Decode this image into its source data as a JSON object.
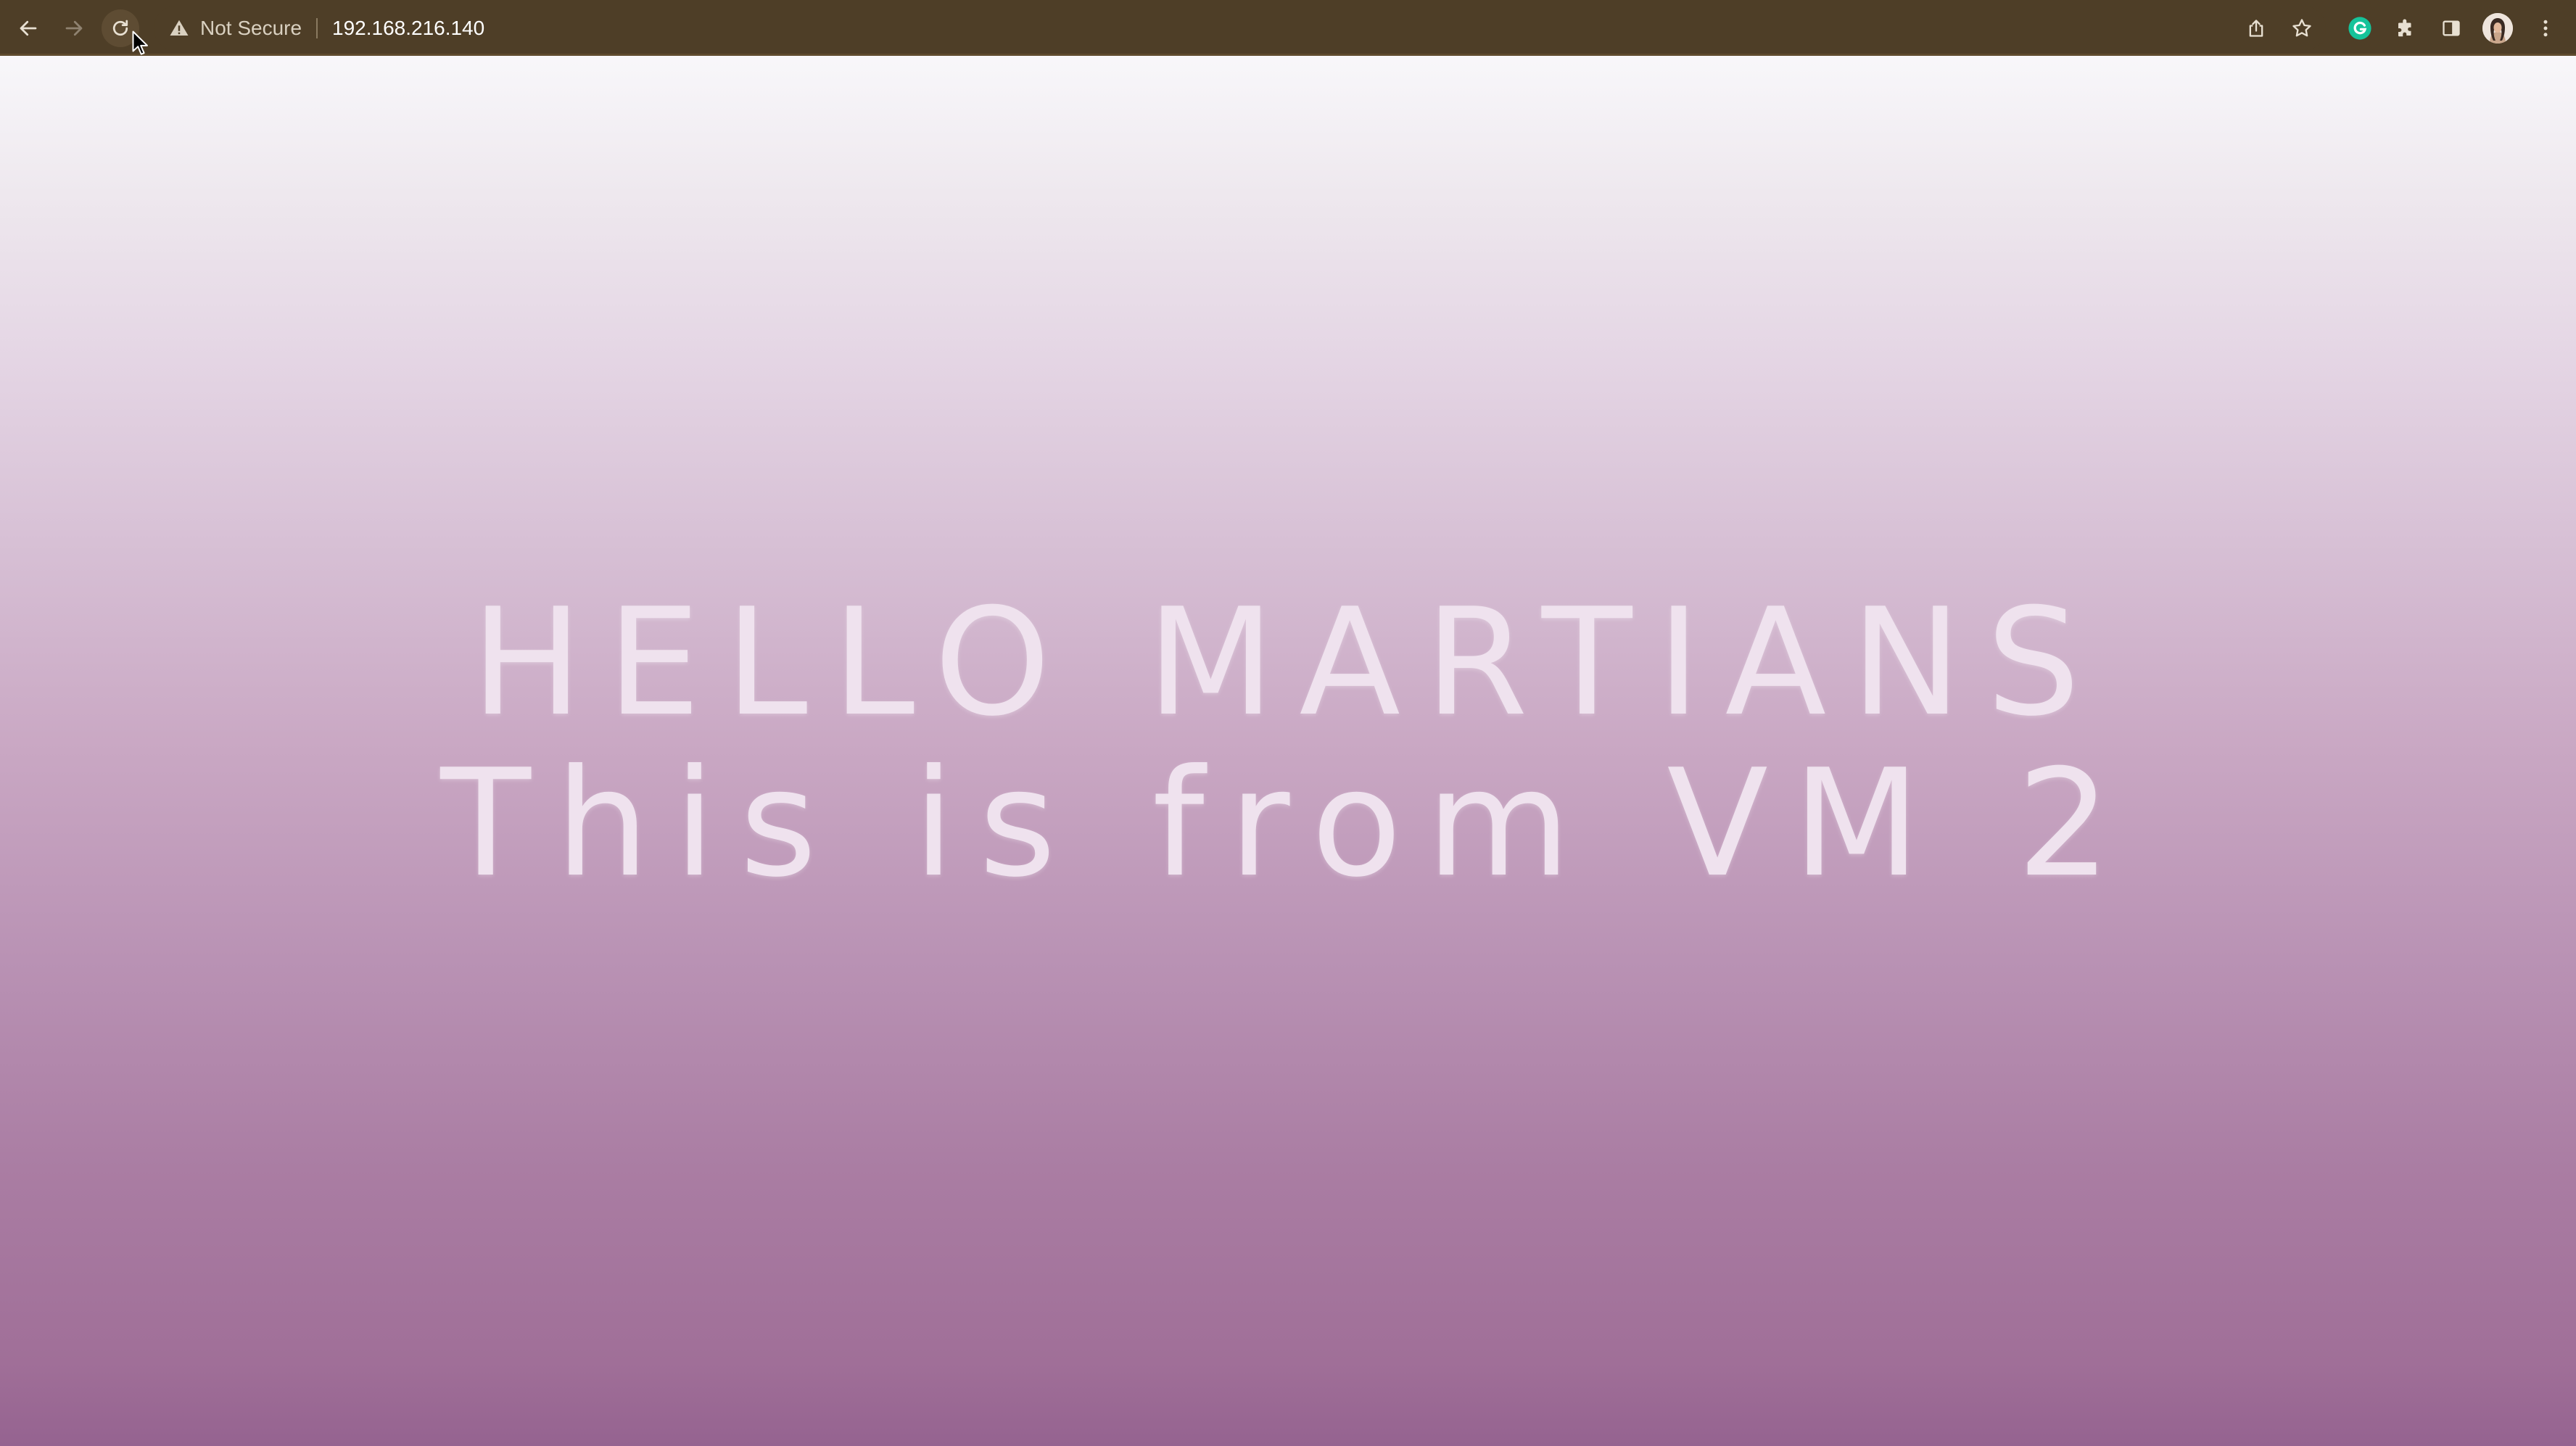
{
  "browser": {
    "toolbar_color": "#4e3e27",
    "nav": {
      "back_icon": "arrow-left-icon",
      "forward_icon": "arrow-right-icon",
      "reload_icon": "reload-icon"
    },
    "omnibox": {
      "security_icon": "warning-triangle-icon",
      "security_label": "Not Secure",
      "url": "192.168.216.140"
    },
    "actions": {
      "share_icon": "share-icon",
      "bookmark_icon": "star-icon",
      "extensions": [
        "grammarly-icon",
        "puzzle-icon"
      ],
      "side_panel_icon": "side-panel-icon",
      "profile_icon": "avatar",
      "menu_icon": "kebab-menu-icon"
    }
  },
  "page": {
    "background_top": "#f8f7fa",
    "background_bottom": "#956390",
    "text_color": "#efe2ee",
    "heading_line1": "HELLO MARTIANS",
    "heading_line2": "This is from VM 2"
  }
}
